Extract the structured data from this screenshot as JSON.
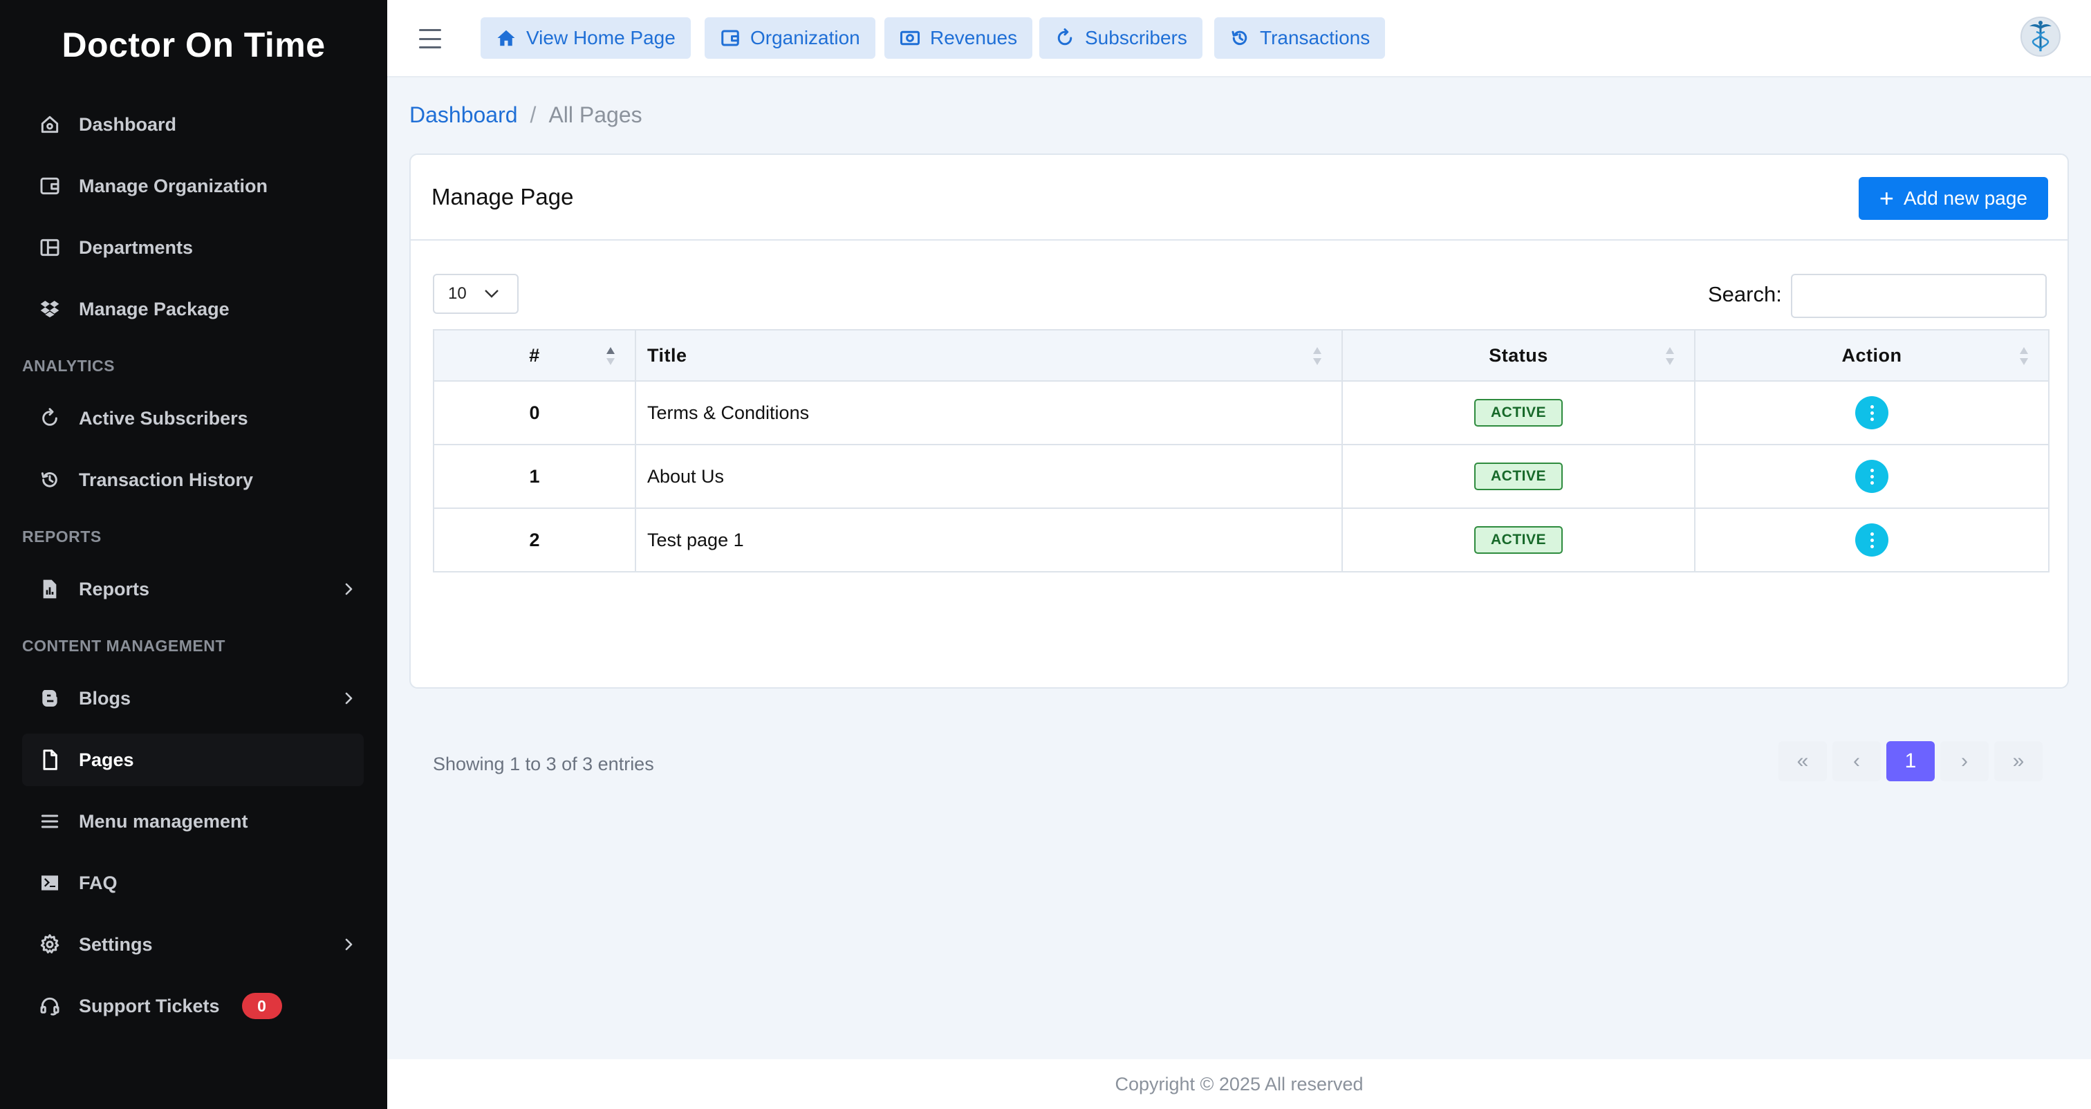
{
  "brand": "Doctor On Time",
  "sidebar": {
    "items": [
      {
        "label": "Dashboard"
      },
      {
        "label": "Manage Organization"
      },
      {
        "label": "Departments"
      },
      {
        "label": "Manage Package"
      }
    ],
    "section_analytics": "ANALYTICS",
    "analytics_items": [
      {
        "label": "Active Subscribers"
      },
      {
        "label": "Transaction History"
      }
    ],
    "section_reports": "REPORTS",
    "reports_items": [
      {
        "label": "Reports"
      }
    ],
    "section_content": "CONTENT MANAGEMENT",
    "content_items": [
      {
        "label": "Blogs"
      },
      {
        "label": "Pages"
      },
      {
        "label": "Menu management"
      },
      {
        "label": "FAQ"
      },
      {
        "label": "Settings"
      },
      {
        "label": "Support Tickets",
        "badge": "0"
      }
    ]
  },
  "topbar": {
    "buttons": [
      {
        "label": "View Home Page",
        "icon": "home-icon"
      },
      {
        "label": "Organization",
        "icon": "wallet-icon"
      },
      {
        "label": "Revenues",
        "icon": "money-icon"
      },
      {
        "label": "Subscribers",
        "icon": "refresh-icon"
      },
      {
        "label": "Transactions",
        "icon": "history-icon"
      }
    ]
  },
  "breadcrumb": {
    "home": "Dashboard",
    "separator": "/",
    "current": "All Pages"
  },
  "card": {
    "title": "Manage Page",
    "add_button": "Add new page",
    "page_length": "10",
    "search_label": "Search:",
    "search_value": ""
  },
  "table": {
    "columns": [
      "#",
      "Title",
      "Status",
      "Action"
    ],
    "rows": [
      {
        "num": "0",
        "title": "Terms & Conditions",
        "status": "ACTIVE"
      },
      {
        "num": "1",
        "title": "About Us",
        "status": "ACTIVE"
      },
      {
        "num": "2",
        "title": "Test page 1",
        "status": "ACTIVE"
      }
    ],
    "info": "Showing 1 to 3 of 3 entries",
    "pager": {
      "first": "«",
      "prev": "‹",
      "current": "1",
      "next": "›",
      "last": "»"
    }
  },
  "footer": "Copyright © 2025 All reserved",
  "colors": {
    "sidebar_bg": "#0d0e10",
    "accent": "#0a7cf2",
    "topbar_button_bg": "#dde9f9",
    "badge_red": "#e0363e",
    "status_green": "#d9f5dd",
    "action_cyan": "#0fc0e8",
    "pager_current": "#6c63ff"
  }
}
